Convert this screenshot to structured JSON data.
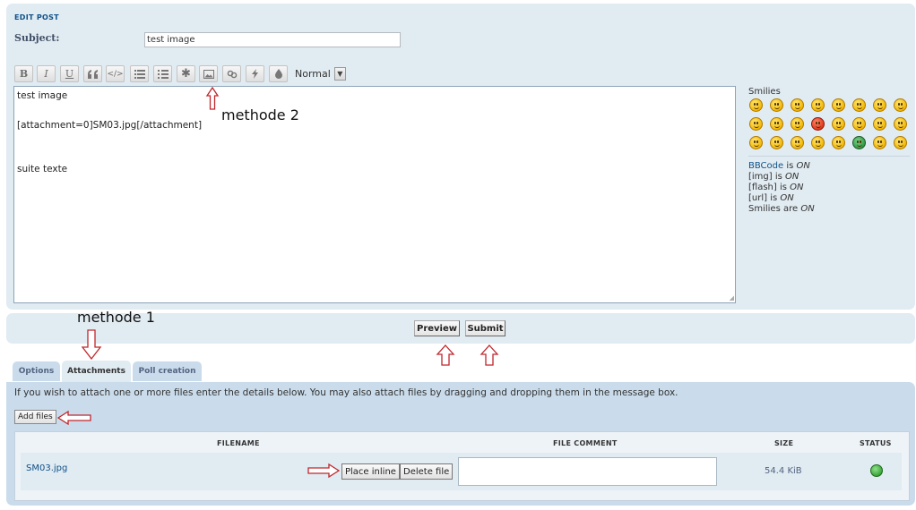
{
  "panel": {
    "title": "EDIT POST"
  },
  "subject": {
    "label": "Subject:",
    "value": "test image"
  },
  "toolbar": {
    "bold": "B",
    "italic": "I",
    "underline": "U",
    "font_size": "Normal"
  },
  "editor": {
    "lines": [
      "test image",
      "[attachment=0]SM03.jpg[/attachment]",
      "suite texte"
    ]
  },
  "annotations": {
    "method2": "methode 2",
    "method1": "methode 1"
  },
  "sidebar": {
    "smilies_title": "Smilies",
    "bbcode_prefix": "BBCode",
    "bbcode_status": "ON",
    "img_label": "[img] is",
    "img_status": "ON",
    "flash_label": "[flash] is",
    "flash_status": "ON",
    "url_label": "[url] is",
    "url_status": "ON",
    "smilies_label": "Smilies are",
    "smilies_status": "ON"
  },
  "actions": {
    "preview": "Preview",
    "submit": "Submit"
  },
  "tabs": [
    {
      "label": "Options"
    },
    {
      "label": "Attachments"
    },
    {
      "label": "Poll creation"
    }
  ],
  "attachments": {
    "info": "If you wish to attach one or more files enter the details below. You may also attach files by dragging and dropping them in the message box.",
    "add_files": "Add files",
    "columns": {
      "filename": "FILENAME",
      "comment": "FILE COMMENT",
      "size": "SIZE",
      "status": "STATUS"
    },
    "file": {
      "name": "SM03.jpg",
      "place_inline": "Place inline",
      "delete": "Delete file",
      "size": "54.4 KiB"
    }
  },
  "colors": {
    "panel_bg": "#e1ebf2",
    "tab_bg": "#cadceb",
    "link": "#105289",
    "annotation_red": "#c0262c"
  }
}
